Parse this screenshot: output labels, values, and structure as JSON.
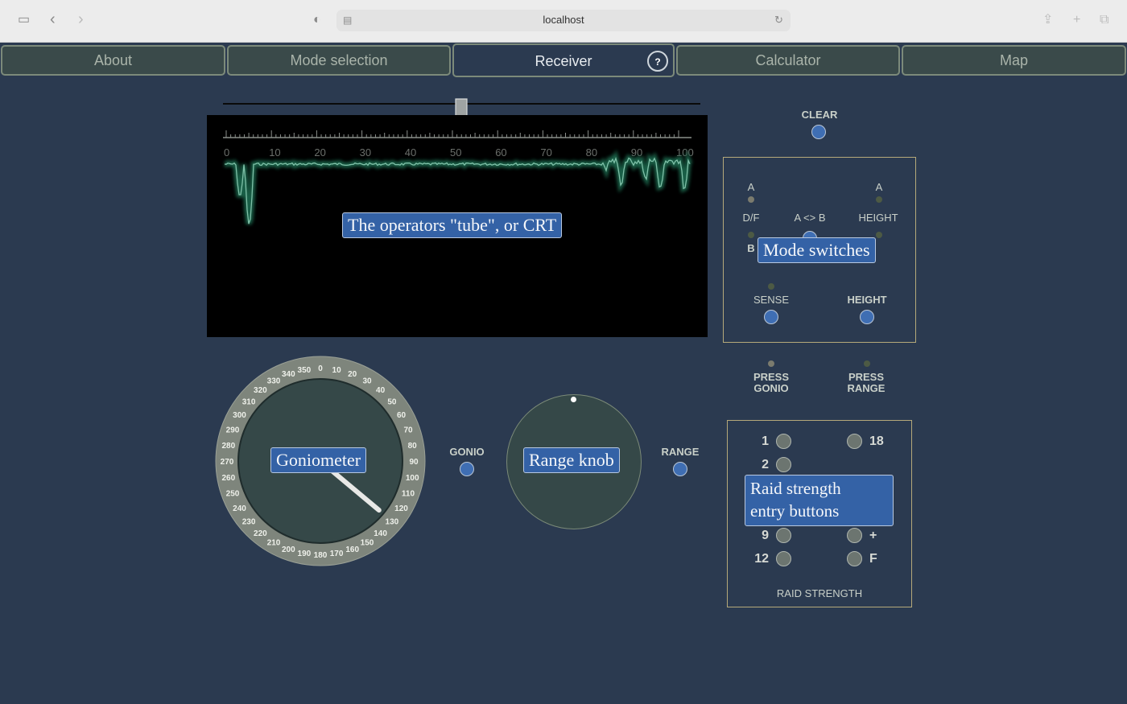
{
  "browser": {
    "url": "localhost"
  },
  "tabs": [
    {
      "label": "About"
    },
    {
      "label": "Mode selection"
    },
    {
      "label": "Receiver",
      "active": true
    },
    {
      "label": "Calculator"
    },
    {
      "label": "Map"
    }
  ],
  "help_label": "?",
  "crt": {
    "scale_labels": [
      "0",
      "10",
      "20",
      "30",
      "40",
      "50",
      "60",
      "70",
      "80",
      "90",
      "100"
    ],
    "slider_value": 50,
    "callout": "The operators \"tube\", or CRT"
  },
  "clear_label": "CLEAR",
  "mode": {
    "a_left": "A",
    "a_right": "A",
    "df": "D/F",
    "ab": "A <> B",
    "height_small": "HEIGHT",
    "b": "B",
    "callout": "Mode switches",
    "sense": "SENSE",
    "height": "HEIGHT"
  },
  "press_gonio": "PRESS GONIO",
  "press_range": "PRESS RANGE",
  "goniometer": {
    "labels": [
      "0",
      "10",
      "20",
      "30",
      "40",
      "50",
      "60",
      "70",
      "80",
      "90",
      "100",
      "110",
      "120",
      "130",
      "140",
      "150",
      "160",
      "170",
      "180",
      "190",
      "200",
      "210",
      "220",
      "230",
      "240",
      "250",
      "260",
      "270",
      "280",
      "290",
      "300",
      "310",
      "320",
      "330",
      "340",
      "350"
    ],
    "bearing": 130,
    "callout": "Goniometer"
  },
  "gonio_label": "GONIO",
  "range_knob": {
    "callout": "Range knob"
  },
  "range_label": "RANGE",
  "raid": {
    "left": [
      "1",
      "2",
      "9",
      "12"
    ],
    "right": [
      "18",
      "+",
      "F"
    ],
    "callout_line1": "Raid strength",
    "callout_line2": "entry buttons",
    "title": "RAID STRENGTH"
  },
  "colors": {
    "background": "#2b3a50",
    "button": "#3f6eb3",
    "callout": "#3462a6",
    "trace": "#5fa58c"
  }
}
